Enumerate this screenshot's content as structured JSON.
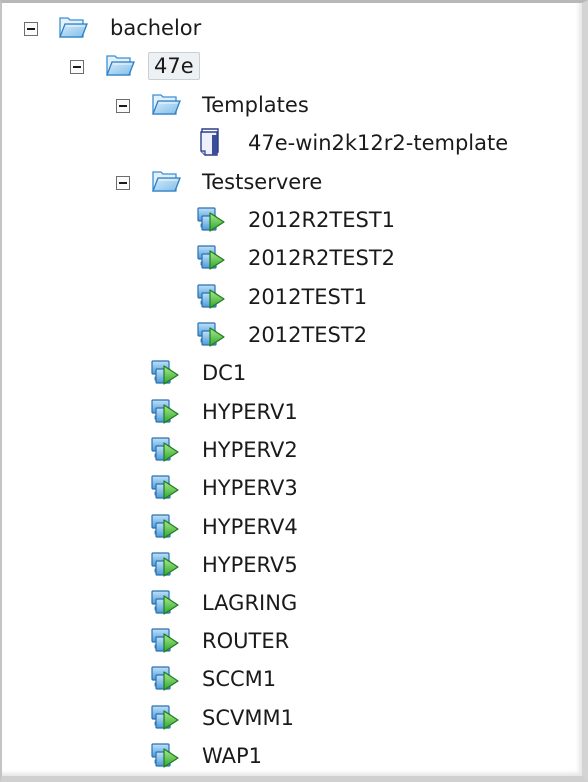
{
  "tree": {
    "root": {
      "label": "bachelor",
      "icon": "folder-open-icon",
      "expanded": true
    },
    "datacenter": {
      "label": "47e",
      "icon": "folder-open-icon",
      "expanded": true,
      "selected": true
    },
    "templates_folder": {
      "label": "Templates",
      "icon": "folder-open-icon",
      "expanded": true
    },
    "templates": [
      {
        "label": "47e-win2k12r2-template",
        "icon": "template-icon"
      }
    ],
    "testservere_folder": {
      "label": "Testservere",
      "icon": "folder-open-icon",
      "expanded": true
    },
    "test_vms": [
      {
        "label": "2012R2TEST1",
        "icon": "vm-icon"
      },
      {
        "label": "2012R2TEST2",
        "icon": "vm-icon"
      },
      {
        "label": "2012TEST1",
        "icon": "vm-icon"
      },
      {
        "label": "2012TEST2",
        "icon": "vm-icon"
      }
    ],
    "vms": [
      {
        "label": "DC1",
        "icon": "vm-icon"
      },
      {
        "label": "HYPERV1",
        "icon": "vm-icon"
      },
      {
        "label": "HYPERV2",
        "icon": "vm-icon"
      },
      {
        "label": "HYPERV3",
        "icon": "vm-icon"
      },
      {
        "label": "HYPERV4",
        "icon": "vm-icon"
      },
      {
        "label": "HYPERV5",
        "icon": "vm-icon"
      },
      {
        "label": "LAGRING",
        "icon": "vm-icon"
      },
      {
        "label": "ROUTER",
        "icon": "vm-icon"
      },
      {
        "label": "SCCM1",
        "icon": "vm-icon"
      },
      {
        "label": "SCVMM1",
        "icon": "vm-icon"
      },
      {
        "label": "WAP1",
        "icon": "vm-icon"
      }
    ]
  },
  "colors": {
    "folder": "#3a8fd6",
    "vm_screen": "#3d8bcf",
    "vm_arrow": "#3cb43c",
    "template": "#2c3e8a"
  }
}
